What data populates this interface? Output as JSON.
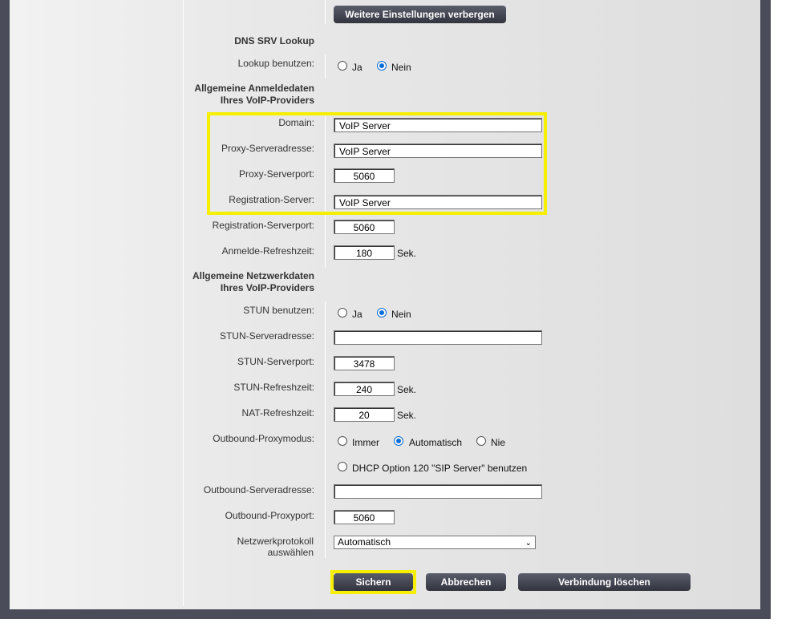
{
  "top_button": "Weitere Einstellungen verbergen",
  "dns": {
    "section": "DNS SRV Lookup",
    "lookup_label": "Lookup benutzen:",
    "opt_yes": "Ja",
    "opt_no": "Nein"
  },
  "login": {
    "section_line1": "Allgemeine Anmeldedaten",
    "section_line2": "Ihres VoIP-Providers",
    "domain_label": "Domain:",
    "domain_value": "VoIP Server",
    "proxy_addr_label": "Proxy-Serveradresse:",
    "proxy_addr_value": "VoIP Server",
    "proxy_port_label": "Proxy-Serverport:",
    "proxy_port_value": "5060",
    "reg_server_label": "Registration-Server:",
    "reg_server_value": "VoIP Server",
    "reg_port_label": "Registration-Serverport:",
    "reg_port_value": "5060",
    "refresh_label": "Anmelde-Refreshzeit:",
    "refresh_value": "180",
    "unit_sec": "Sek."
  },
  "network": {
    "section_line1": "Allgemeine Netzwerkdaten",
    "section_line2": "Ihres VoIP-Providers",
    "stun_use_label": "STUN benutzen:",
    "opt_yes": "Ja",
    "opt_no": "Nein",
    "stun_addr_label": "STUN-Serveradresse:",
    "stun_addr_value": "",
    "stun_port_label": "STUN-Serverport:",
    "stun_port_value": "3478",
    "stun_refresh_label": "STUN-Refreshzeit:",
    "stun_refresh_value": "240",
    "nat_refresh_label": "NAT-Refreshzeit:",
    "nat_refresh_value": "20",
    "unit_sec": "Sek.",
    "outbound_mode_label": "Outbound-Proxymodus:",
    "mode_always": "Immer",
    "mode_auto": "Automatisch",
    "mode_never": "Nie",
    "dhcp_option": "DHCP Option 120 \"SIP Server\" benutzen",
    "outbound_addr_label": "Outbound-Serveradresse:",
    "outbound_addr_value": "",
    "outbound_port_label": "Outbound-Proxyport:",
    "outbound_port_value": "5060",
    "protocol_label_line1": "Netzwerkprotokoll",
    "protocol_label_line2": "auswählen",
    "protocol_value": "Automatisch"
  },
  "actions": {
    "save": "Sichern",
    "cancel": "Abbrechen",
    "delete": "Verbindung löschen"
  },
  "colors": {
    "highlight": "#f6ef00",
    "radio_checked": "#0a6cd6",
    "button_bg": "#3f414c"
  }
}
